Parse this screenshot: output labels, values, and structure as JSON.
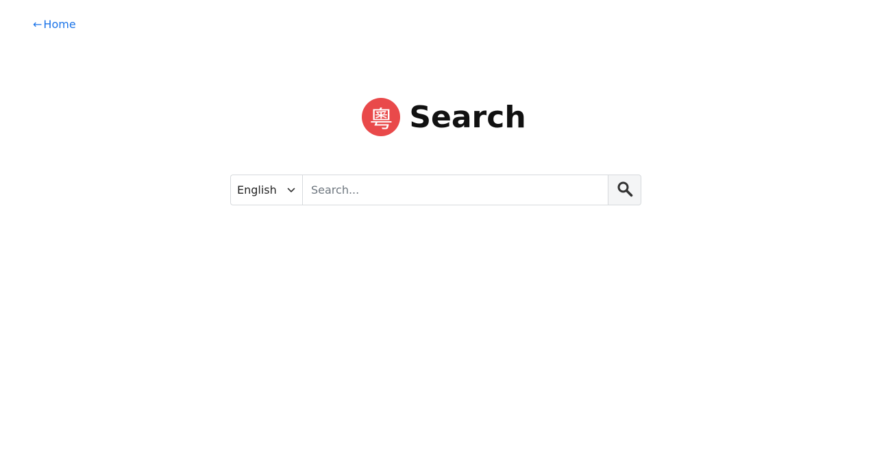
{
  "nav": {
    "home_arrow": "←",
    "home_label": "Home"
  },
  "header": {
    "logo_glyph": "粵",
    "title": "Search"
  },
  "search": {
    "language_selected": "English",
    "placeholder": "Search...",
    "value": ""
  },
  "icons": {
    "chevron": "chevron-down-icon",
    "search": "search-icon"
  },
  "colors": {
    "link": "#1a73e8",
    "logo_bg": "#e9494a"
  }
}
